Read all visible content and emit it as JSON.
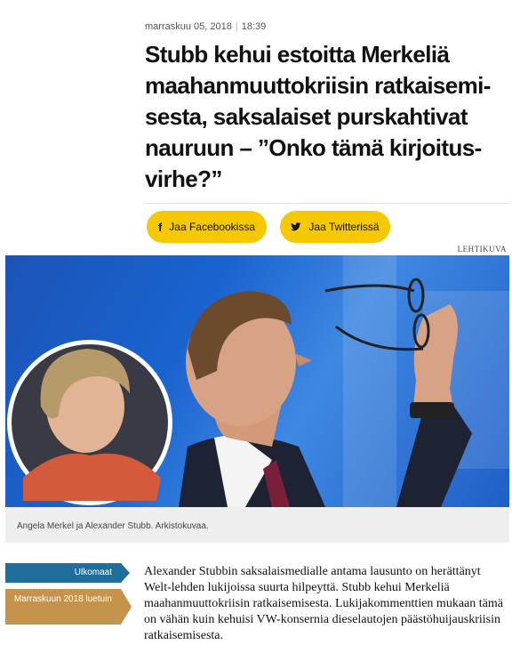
{
  "article": {
    "date": "marraskuu 05, 2018",
    "time": "18:39",
    "headline": "Stubb kehui estoitta Merkeliä maahanmuuttokriisin ratkaisemi-sesta, saksalaiset purskahtivat nauruun – ”Onko tämä kirjoitus-virhe?”",
    "share": {
      "facebook_label": "Jaa Facebookissa",
      "twitter_label": "Jaa Twitterissä",
      "facebook_icon": "f",
      "twitter_icon": "🐦"
    },
    "photo_credit": "LEHTIKUVA",
    "caption": "Angela Merkel ja Alexander Stubb. Arkistokuvaa.",
    "tags": {
      "category": "Ulkomaat",
      "most_read": "Marraskuun 2018 luetuin"
    },
    "body": "Alexander Stubbin saksalaismedialle antama lausunto on herättänyt Welt-lehden lukijoissa suurta hilpeyttä. Stubb kehui Merkeliä maahanmuuttokriisin ratkaisemisesta. Lukijakommenttien mukaan tämä on vähän kuin kehuisi VW-konsernia dieselautojen päästöhuijauskriisin ratkaisemisesta."
  },
  "colors": {
    "share_yellow": "#f5c800",
    "category_blue": "#1f6e9c",
    "date_gold": "#c4944c"
  }
}
